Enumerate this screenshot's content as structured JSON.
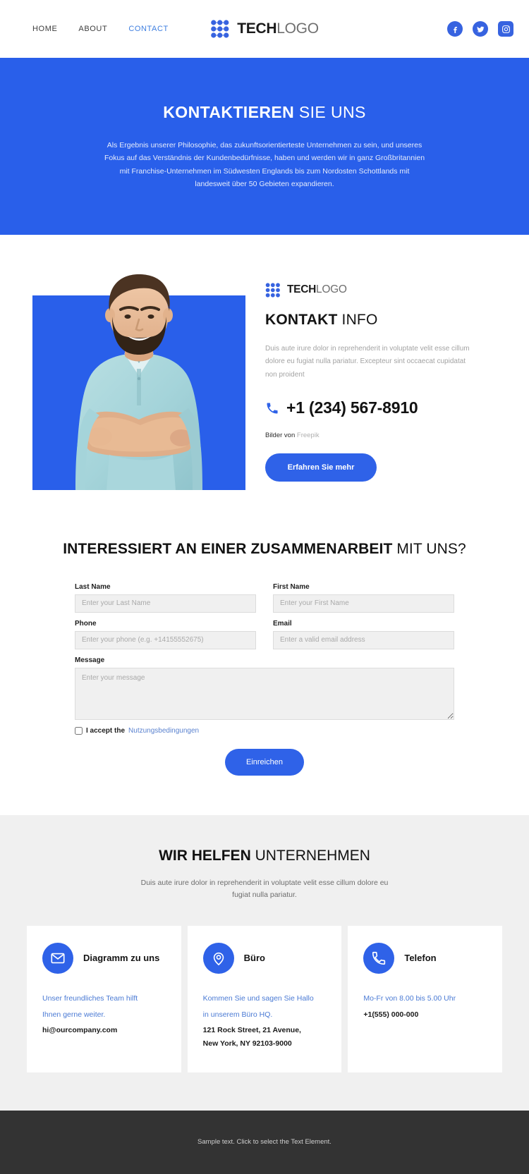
{
  "header": {
    "nav": [
      {
        "label": "HOME",
        "active": false
      },
      {
        "label": "ABOUT",
        "active": false
      },
      {
        "label": "CONTACT",
        "active": true
      }
    ],
    "logo": {
      "bold": "TECH",
      "light": "LOGO"
    },
    "socials": [
      {
        "name": "facebook-icon",
        "label": "Facebook"
      },
      {
        "name": "twitter-icon",
        "label": "Twitter"
      },
      {
        "name": "instagram-icon",
        "label": "Instagram"
      }
    ]
  },
  "hero": {
    "title_strong": "KONTAKTIEREN",
    "title_light": " SIE UNS",
    "paragraph": "Als Ergebnis unserer Philosophie, das zukunftsorientierteste Unternehmen zu sein, und unseres Fokus auf das Verständnis der Kundenbedürfnisse, haben und werden wir in ganz Großbritannien mit Franchise-Unternehmen im Südwesten Englands bis zum Nordosten Schottlands mit landesweit über 50 Gebieten expandieren.",
    "bg_color": "#295fea"
  },
  "info": {
    "logo": {
      "bold": "TECH",
      "light": "LOGO"
    },
    "title_strong": "KONTAKT",
    "title_light": " INFO",
    "description": "Duis aute irure dolor in reprehenderit in voluptate velit esse cillum dolore eu fugiat nulla pariatur. Excepteur sint occaecat cupidatat non proident",
    "phone": "+1 (234) 567-8910",
    "credit_prefix": "Bilder von ",
    "credit_link": "Freepik",
    "button": "Erfahren Sie mehr"
  },
  "form": {
    "title_strong": "INTERESSIERT AN EINER ZUSAMMENARBEIT",
    "title_light": " MIT UNS?",
    "fields": {
      "last_name": {
        "label": "Last Name",
        "placeholder": "Enter your Last Name",
        "value": ""
      },
      "first_name": {
        "label": "First Name",
        "placeholder": "Enter your First Name",
        "value": ""
      },
      "phone": {
        "label": "Phone",
        "placeholder": "Enter your phone (e.g. +14155552675)",
        "value": ""
      },
      "email": {
        "label": "Email",
        "placeholder": "Enter a valid email address",
        "value": ""
      },
      "message": {
        "label": "Message",
        "placeholder": "Enter your message",
        "value": ""
      }
    },
    "accept_label": "I accept the",
    "accept_link": "Nutzungsbedingungen",
    "submit": "Einreichen"
  },
  "help": {
    "title_strong": "WIR HELFEN",
    "title_light": " UNTERNEHMEN",
    "subtitle": "Duis aute irure dolor in reprehenderit in voluptate velit esse cillum dolore eu fugiat nulla pariatur.",
    "cards": [
      {
        "icon": "envelope-icon",
        "title": "Diagramm zu uns",
        "link_line1": "Unser freundliches Team hilft",
        "link_line2": "Ihnen gerne weiter.",
        "body_line1": "hi@ourcompany.com",
        "body_line2": ""
      },
      {
        "icon": "map-pin-icon",
        "title": "Büro",
        "link_line1": "Kommen Sie und sagen Sie Hallo",
        "link_line2": "in unserem Büro HQ.",
        "body_line1": "121 Rock Street, 21 Avenue,",
        "body_line2": "New York, NY 92103-9000"
      },
      {
        "icon": "phone-icon",
        "title": "Telefon",
        "link_line1": "Mo-Fr von 8.00 bis 5.00 Uhr",
        "link_line2": "",
        "body_line1": "+1(555) 000-000",
        "body_line2": ""
      }
    ]
  },
  "footer": {
    "text": "Sample text. Click to select the Text Element."
  },
  "colors": {
    "accent": "#2f62e8",
    "hero": "#295fea",
    "link": "#4a7ad4",
    "footer_bg": "#333333",
    "section_bg": "#f0f0f0"
  }
}
